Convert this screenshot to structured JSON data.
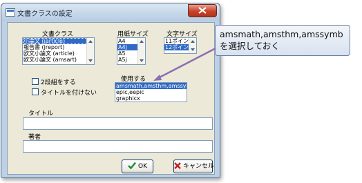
{
  "window": {
    "title": "文書クラスの設定"
  },
  "docclass": {
    "label": "文書クラス",
    "items": [
      "小論文 (jarticle)",
      "報告書 (jreport)",
      "欧文小論文 (article)",
      "欧文小論文 (amsart)"
    ],
    "selected_index": 0
  },
  "paper": {
    "label": "用紙サイズ",
    "items": [
      "A4",
      "A4j",
      "A5",
      "A5j"
    ],
    "selected_index": 1
  },
  "fontsize": {
    "label": "文字サイズ",
    "items": [
      "11ポイン",
      "12ポイン"
    ],
    "selected_index": 1
  },
  "options": {
    "twocolumn_label": "2段組をする",
    "notitle_label": "タイトルを付けない"
  },
  "packages": {
    "label": "使用する",
    "items": [
      "amsmath,amsthm,amssymb",
      "epic,eepic",
      "graphicx"
    ],
    "selected_index": 0
  },
  "title_field": {
    "label": "タイトル",
    "value": ""
  },
  "author_field": {
    "label": "著者",
    "value": ""
  },
  "buttons": {
    "ok": "OK",
    "cancel": "キャンセル"
  },
  "callout": {
    "line1": "amsmath,amsthm,amssymb",
    "line2": "を選択しておく"
  },
  "colors": {
    "selection": "#316ac5",
    "dialog_bg": "#ece9d8",
    "callout_border": "#6d7fa5",
    "arrow": "#8a6fb3"
  }
}
